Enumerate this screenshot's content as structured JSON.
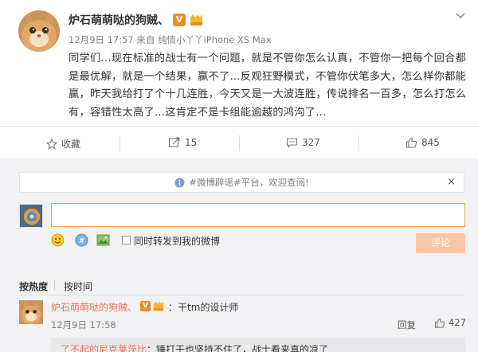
{
  "post": {
    "username": "炉石萌萌哒的狗贼、",
    "verified_badge": "V",
    "timestamp": "12月9日 17:57",
    "source_prefix": "来自",
    "source": "纯情小丫丫iPhone XS Max",
    "text": "同学们...现在标准的战士有一个问题，就是不管你怎么认真，不管你一把每个回合都是最优解，就是一个结果，赢不了...反观狂野模式，不管你伏笔多大，怎么样你都能赢，昨天我给打了个十几连胜，今天又是一大波连胜，传说排名一百多，怎么打怎么有，容错性太高了...这肯定不是卡组能逾越的鸿沟了..."
  },
  "actions": {
    "favorite_label": "收藏",
    "repost_count": "15",
    "comment_count": "327",
    "like_count": "845"
  },
  "comment_section": {
    "notice_text": "#微博辟谣#平台，欢迎查阅!",
    "notice_close": "×",
    "input_value": "",
    "repost_checkbox_label": "同时转发到我的微博",
    "submit_label": "评论",
    "sort_tabs": [
      "按热度",
      "按时间"
    ]
  },
  "comments": [
    {
      "username": "炉石萌萌哒的狗贼、",
      "verified_badge": "V",
      "text": "：干tm的设计师",
      "time": "12月9日 17:58",
      "reply_label": "回复",
      "like_count": "427",
      "reply_preview": "了不起的尼克莱茨比：锤打干也坚持不住了，战士看来真的凉了"
    }
  ],
  "icons": {
    "menu": "chevron-down-icon",
    "favorite": "star-icon",
    "repost": "repost-icon",
    "comment": "comment-icon",
    "like": "thumbs-up-icon",
    "notice": "info-icon",
    "emoji": "emoji-icon",
    "image": "image-icon",
    "topic": "topic-icon"
  },
  "colors": {
    "link": "#eb7350",
    "submit_disabled": "#fcc5a7",
    "input_border": "#f0a050",
    "background_gray": "#f2f2f5"
  }
}
